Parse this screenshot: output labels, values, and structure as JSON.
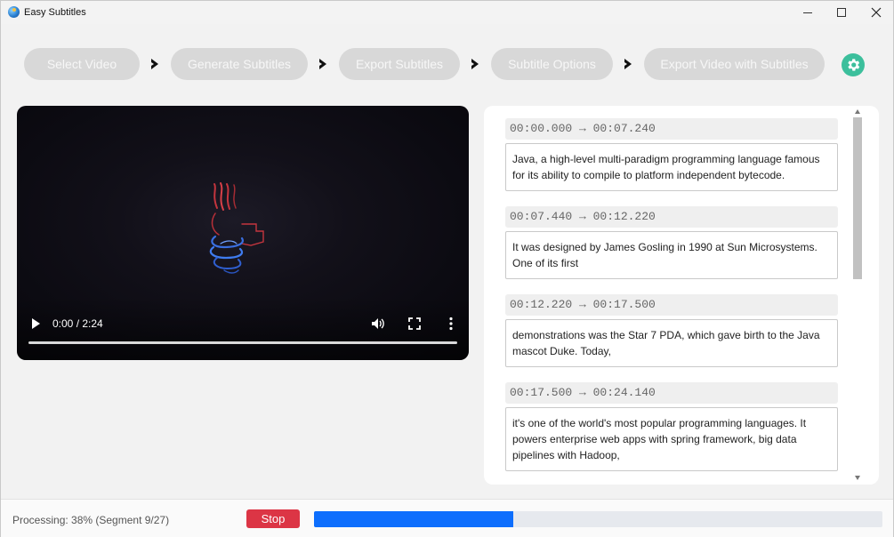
{
  "window": {
    "title": "Easy Subtitles"
  },
  "steps": [
    {
      "label": "Select Video"
    },
    {
      "label": "Generate Subtitles"
    },
    {
      "label": "Export Subtitles"
    },
    {
      "label": "Subtitle Options"
    },
    {
      "label": "Export Video with Subtitles"
    }
  ],
  "video": {
    "time": "0:00 / 2:24"
  },
  "subtitles": [
    {
      "time": "00:00.000 → 00:07.240",
      "text": "Java, a high-level multi-paradigm programming language famous for its ability to compile to platform independent bytecode."
    },
    {
      "time": "00:07.440 → 00:12.220",
      "text": "It was designed by James Gosling in 1990 at Sun Microsystems. One of its first"
    },
    {
      "time": "00:12.220 → 00:17.500",
      "text": "demonstrations was the Star 7 PDA, which gave birth to the Java mascot Duke. Today,"
    },
    {
      "time": "00:17.500 → 00:24.140",
      "text": "it's one of the world's most popular programming languages. It powers enterprise web apps with spring framework, big data pipelines with Hadoop,"
    }
  ],
  "status": {
    "text": "Processing: 38% (Segment 9/27)",
    "stop_label": "Stop",
    "progress_fraction": 0.35
  },
  "colors": {
    "accent_green": "#3cbf9c",
    "stop_red": "#dc3545",
    "progress_blue": "#0d6efd"
  },
  "icons": {
    "app": "globe-icon",
    "settings": "gear-icon",
    "step_separator": "chevron-right-icon"
  }
}
